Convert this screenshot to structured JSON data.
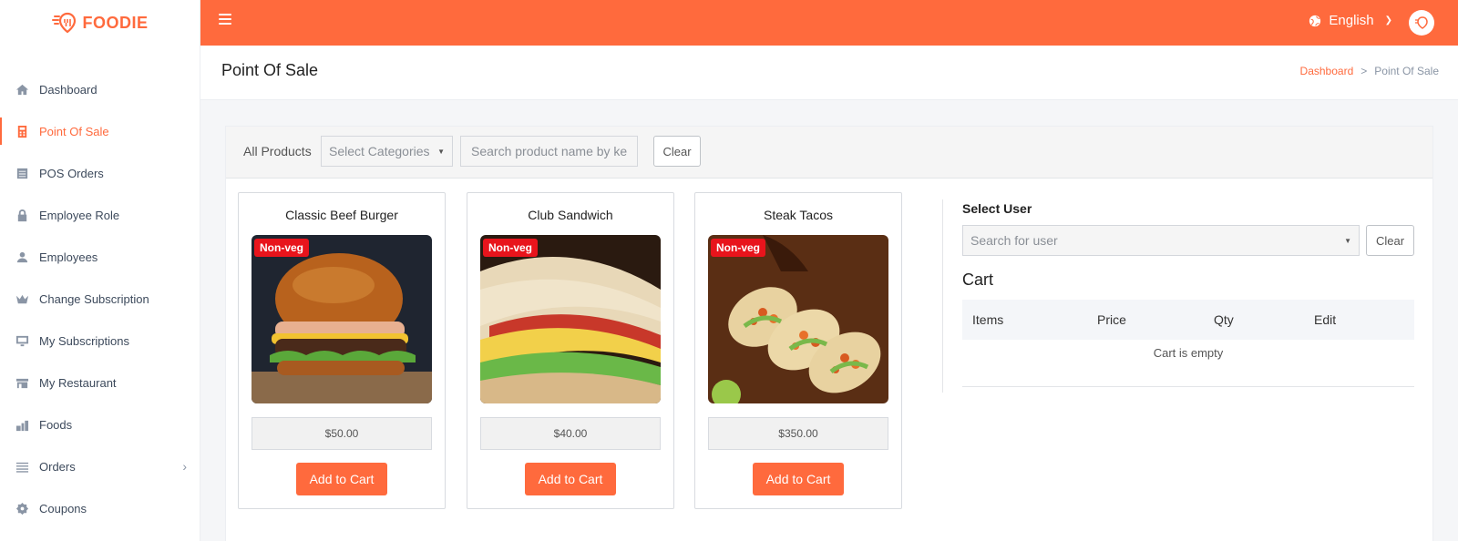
{
  "brand": {
    "name": "FOODIE",
    "accent": "#ff6a3d"
  },
  "sidebar": {
    "items": [
      {
        "label": "Dashboard",
        "icon": "home-icon"
      },
      {
        "label": "Point Of Sale",
        "icon": "calculator-icon",
        "active": true
      },
      {
        "label": "POS Orders",
        "icon": "list-icon"
      },
      {
        "label": "Employee Role",
        "icon": "lock-icon"
      },
      {
        "label": "Employees",
        "icon": "user-icon"
      },
      {
        "label": "Change Subscription",
        "icon": "crown-icon"
      },
      {
        "label": "My Subscriptions",
        "icon": "monitor-icon"
      },
      {
        "label": "My Restaurant",
        "icon": "store-icon"
      },
      {
        "label": "Foods",
        "icon": "food-icon"
      },
      {
        "label": "Orders",
        "icon": "menu-lines-icon",
        "has_children": true
      },
      {
        "label": "Coupons",
        "icon": "gear-badge-icon"
      }
    ]
  },
  "header": {
    "language": "English"
  },
  "page": {
    "title": "Point Of Sale",
    "breadcrumb": {
      "home": "Dashboard",
      "separator": ">",
      "current": "Point Of Sale"
    }
  },
  "filters": {
    "all_products_label": "All Products",
    "category_placeholder": "Select Categories",
    "search_placeholder": "Search product name by keyword",
    "clear_label": "Clear"
  },
  "products": [
    {
      "name": "Classic Beef Burger",
      "badge": "Non-veg",
      "price": "$50.00",
      "add_label": "Add to Cart"
    },
    {
      "name": "Club Sandwich",
      "badge": "Non-veg",
      "price": "$40.00",
      "add_label": "Add to Cart"
    },
    {
      "name": "Steak Tacos",
      "badge": "Non-veg",
      "price": "$350.00",
      "add_label": "Add to Cart"
    }
  ],
  "cart": {
    "select_user_label": "Select User",
    "user_placeholder": "Search for user",
    "clear_label": "Clear",
    "title": "Cart",
    "columns": [
      "Items",
      "Price",
      "Qty",
      "Edit"
    ],
    "empty_text": "Cart is empty"
  }
}
